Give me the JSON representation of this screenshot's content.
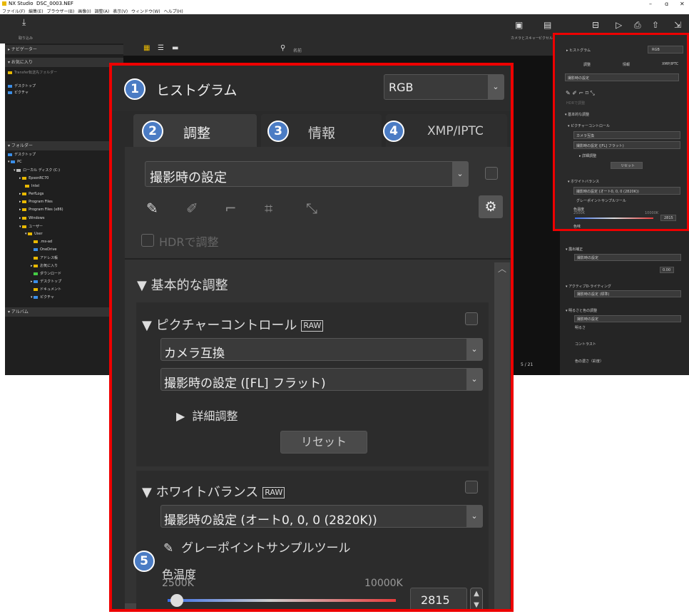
{
  "window": {
    "app": "NX Studio",
    "file": "DSC_0003.NEF",
    "min": "–",
    "max": "ɑ",
    "close": "✕"
  },
  "menu": [
    "ファイル(F)",
    "編集(E)",
    "ブラウザー(B)",
    "画像(I)",
    "調整(A)",
    "表示(V)",
    "ウィンドウ(W)",
    "ヘルプ(H)"
  ],
  "toolbar": {
    "import_label": "取り込み",
    "camera_label": "カメラとスキャー",
    "viewer_label": "ピクセル"
  },
  "left": {
    "navigator": "ナビゲーター",
    "favorites": "お気に入り",
    "fav_items": [
      "Transfer転送先フォルダー",
      "デスクトップ",
      "ピクチャ"
    ],
    "folders": "フォルダー",
    "folder_items": [
      "デスクトップ",
      "PC",
      "ローカル ディスク (C:)",
      "EpsonRC70",
      "Intel",
      "PerfLogs",
      "Program Files",
      "Program Files (x86)",
      "Windows",
      "ユーザー",
      "User",
      ".ms-ad",
      "OneDrive",
      "アドレス帳",
      "お気に入り",
      "ダウンロード",
      "デスクトップ",
      "ドキュメント",
      "ピクチャ"
    ],
    "album": "アルバム"
  },
  "center": {
    "counter": "5 / 21",
    "filter_label": "名前"
  },
  "panel": {
    "histogram_title": "ヒストグラム",
    "histogram_mode": "RGB",
    "tabs": [
      {
        "n": "2",
        "label": "調整"
      },
      {
        "n": "3",
        "label": "情報"
      },
      {
        "n": "4",
        "label": "XMP/IPTC"
      }
    ],
    "badge1": "1",
    "badge5": "5",
    "preset": "撮影時の設定",
    "hdr": "HDRで調整",
    "basic": "基本的な調整",
    "picture_control": "ピクチャーコントロール",
    "raw": "RAW",
    "pc_value1": "カメラ互換",
    "pc_value2": "撮影時の設定 ([FL] フラット)",
    "detail": "詳細調整",
    "reset": "リセット",
    "wb": "ホワイトバランス",
    "wb_value": "撮影時の設定 (オート0, 0, 0 (2820K))",
    "gray_tool": "グレーポイントサンプルツール",
    "temp_label": "色温度",
    "temp_min": "2500K",
    "temp_max": "10000K",
    "temp_value": "2815",
    "tint_label": "色味",
    "temp_slider_pct": 0.04
  },
  "mini": {
    "histogram": "ヒストグラム",
    "mode": "RGB",
    "tabs": [
      "調整",
      "情報",
      "XMP/IPTC"
    ],
    "preset": "撮影時の設定",
    "hdr": "HDRで調整",
    "basic": "基本的な調整",
    "pc": "ピクチャーコントロール",
    "pc1": "カメラ互換",
    "pc2": "撮影時の設定 ([FL] フラット)",
    "detail": "詳細調整",
    "reset": "リセット",
    "wb": "ホワイトバランス",
    "wb_value": "撮影時の設定 (オート0, 0, 0 (2820K))",
    "gray": "グレーポイントサンプルツール",
    "temp": "色温度",
    "tmin": "2500K",
    "tmax": "10000K",
    "tval": "2815",
    "tint": "色味",
    "exposure": "露出補正",
    "exp_value": "撮影時の設定",
    "exp_num": "0.00",
    "adl": "アクティブD-ライティング",
    "adl_value": "撮影時の設定 (標準)",
    "bc": "明るさと色の調整",
    "bc_value": "撮影時の設定",
    "brightness": "明るさ",
    "contrast": "コントラスト",
    "saturation": "色の濃さ（彩度）",
    "zero": "0"
  }
}
